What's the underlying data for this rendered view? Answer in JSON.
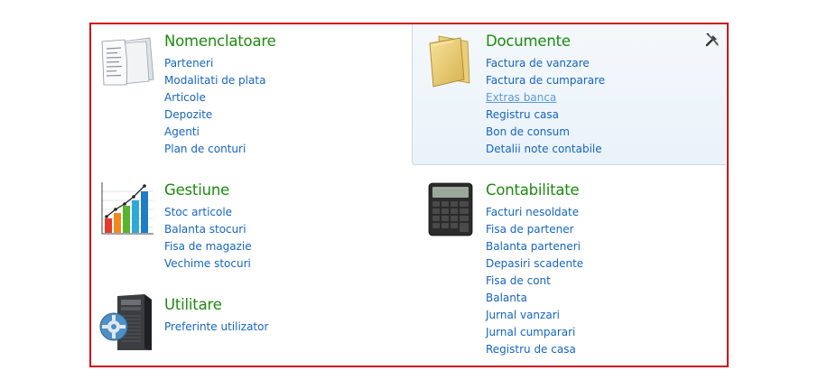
{
  "sections": {
    "nomenclatoare": {
      "title": "Nomenclatoare",
      "links": [
        "Parteneri",
        "Modalitati de plata",
        "Articole",
        "Depozite",
        "Agenti",
        "Plan de conturi"
      ]
    },
    "documente": {
      "title": "Documente",
      "links": [
        "Factura de vanzare",
        "Factura de cumparare",
        "Extras banca",
        "Registru casa",
        "Bon de consum",
        "Detalii note contabile"
      ]
    },
    "gestiune": {
      "title": "Gestiune",
      "links": [
        "Stoc articole",
        "Balanta stocuri",
        "Fisa de magazie",
        "Vechime stocuri"
      ]
    },
    "contabilitate": {
      "title": "Contabilitate",
      "links": [
        "Facturi nesoldate",
        "Fisa de partener",
        "Balanta parteneri",
        "Depasiri scadente",
        "Fisa de cont",
        "Balanta",
        "Jurnal vanzari",
        "Jurnal cumparari",
        "Registru de casa"
      ]
    },
    "utilitare": {
      "title": "Utilitare",
      "links": [
        "Preferinte utilizator"
      ]
    }
  },
  "colors": {
    "frame_border": "#d00f16",
    "title_green": "#1e8a10",
    "link_blue": "#1565c0",
    "link_hover": "#5a9bd6"
  },
  "icons": {
    "nomenclatoare": "documents-stack-icon",
    "documente": "folder-icon",
    "gestiune": "bar-chart-icon",
    "contabilitate": "calculator-icon",
    "utilitare": "server-gear-icon",
    "tools": "tools-icon"
  },
  "hovered_link": "Extras banca"
}
